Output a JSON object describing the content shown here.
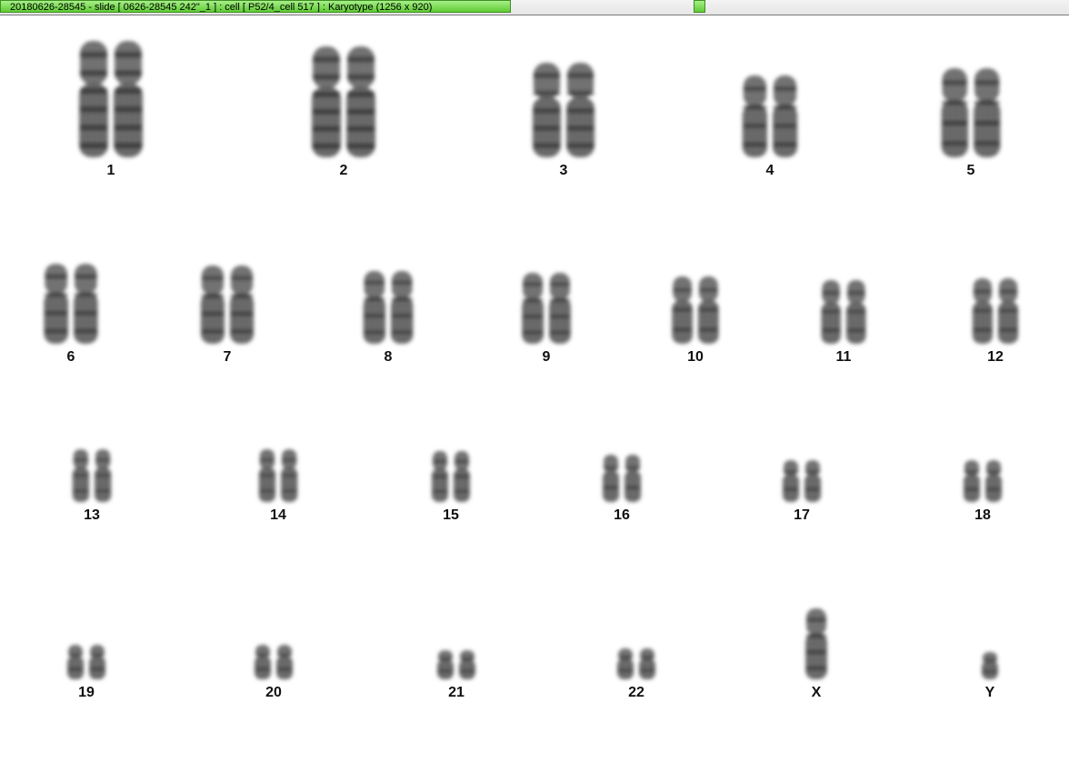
{
  "window": {
    "title": "20180626-28545 - slide [ 0626-28545 242\"_1 ] : cell [ P52/4_cell 517 ] : Karyotype  (1256 x 920)"
  },
  "colors": {
    "title_tab": "#6ed640",
    "chromosome": "#4a4a4a",
    "label": "#111111",
    "background": "#ffffff"
  },
  "karyotype": {
    "chromosomes": [
      {
        "label": "1"
      },
      {
        "label": "2"
      },
      {
        "label": "3"
      },
      {
        "label": "4"
      },
      {
        "label": "5"
      },
      {
        "label": "6"
      },
      {
        "label": "7"
      },
      {
        "label": "8"
      },
      {
        "label": "9"
      },
      {
        "label": "10"
      },
      {
        "label": "11"
      },
      {
        "label": "12"
      },
      {
        "label": "13"
      },
      {
        "label": "14"
      },
      {
        "label": "15"
      },
      {
        "label": "16"
      },
      {
        "label": "17"
      },
      {
        "label": "18"
      },
      {
        "label": "19"
      },
      {
        "label": "20"
      },
      {
        "label": "21"
      },
      {
        "label": "22"
      },
      {
        "label": "X"
      },
      {
        "label": "Y"
      }
    ]
  }
}
